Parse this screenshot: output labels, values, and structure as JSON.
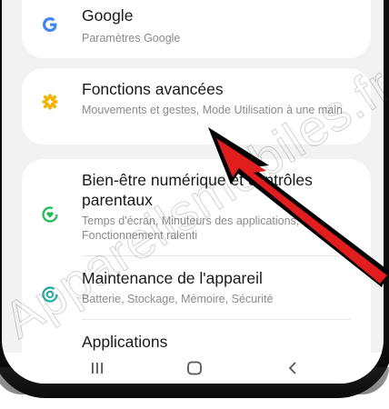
{
  "items": [
    {
      "title": "Google",
      "subtitle": "Paramètres Google",
      "icon": "google-icon",
      "icon_color": "#4285F4"
    },
    {
      "title": "Fonctions avancées",
      "subtitle": "Mouvements et gestes, Mode Utilisation à une main",
      "icon": "gear-plus-icon",
      "icon_color": "#F4B400"
    },
    {
      "title": "Bien-être numérique et contrôles parentaux",
      "subtitle": "Temps d'écran, Minuteurs des applications, Fonctionnement ralenti",
      "icon": "wellbeing-icon",
      "icon_color": "#1DB954"
    },
    {
      "title": "Maintenance de l'appareil",
      "subtitle": "Batterie, Stockage, Mémoire, Sécurité",
      "icon": "device-care-icon",
      "icon_color": "#20B2AA"
    },
    {
      "title": "Applications",
      "subtitle": "",
      "icon": "apps-icon",
      "icon_color": "#5C6BC0"
    }
  ],
  "navbar": {
    "recents_icon": "recents-icon",
    "home_icon": "home-icon",
    "back_icon": "back-icon"
  },
  "watermark": "Appareilsmobiles.fr",
  "colors": {
    "background": "#f2f2f2",
    "card": "#ffffff",
    "arrow_fill": "#e11d1d",
    "arrow_outline": "#000000"
  }
}
